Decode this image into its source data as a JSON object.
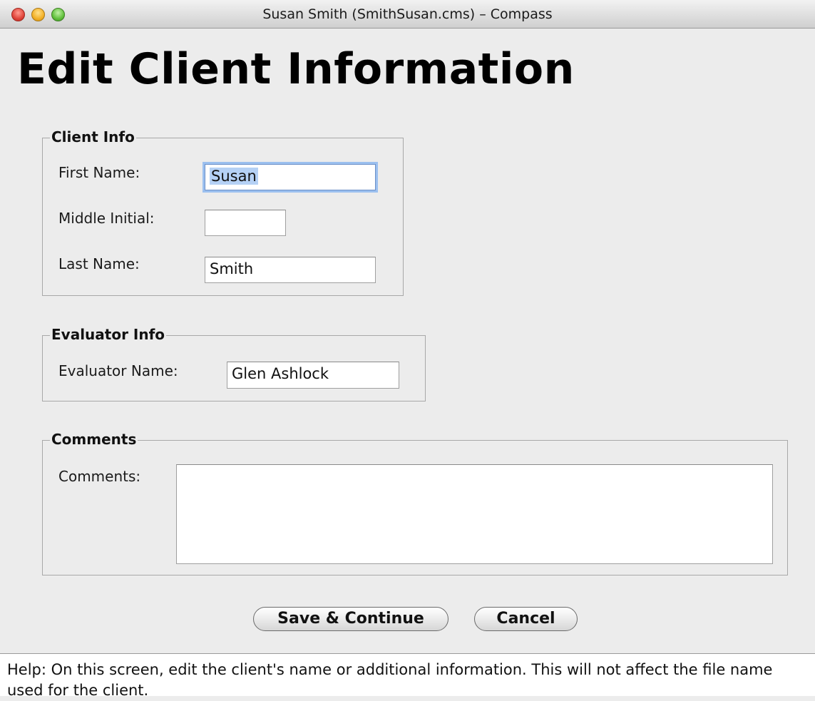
{
  "window": {
    "title": "Susan Smith (SmithSusan.cms) – Compass"
  },
  "page": {
    "title": "Edit Client Information"
  },
  "client_info": {
    "legend": "Client Info",
    "first_name_label": "First Name:",
    "first_name_value": "Susan",
    "middle_initial_label": "Middle Initial:",
    "middle_initial_value": "",
    "last_name_label": "Last Name:",
    "last_name_value": "Smith"
  },
  "evaluator_info": {
    "legend": "Evaluator Info",
    "evaluator_name_label": "Evaluator Name:",
    "evaluator_name_value": "Glen Ashlock"
  },
  "comments": {
    "legend": "Comments",
    "comments_label": "Comments:",
    "comments_value": ""
  },
  "buttons": {
    "save_label": "Save & Continue",
    "cancel_label": "Cancel"
  },
  "help": {
    "text": "Help:  On this screen, edit the client's name or additional information.  This will not affect the file name used for the client."
  },
  "colors": {
    "focus_ring": "#9cc0ef",
    "selection": "#b5d1f5",
    "window_bg": "#ececec"
  },
  "icons": [
    "close-window-icon",
    "minimize-window-icon",
    "zoom-window-icon"
  ]
}
